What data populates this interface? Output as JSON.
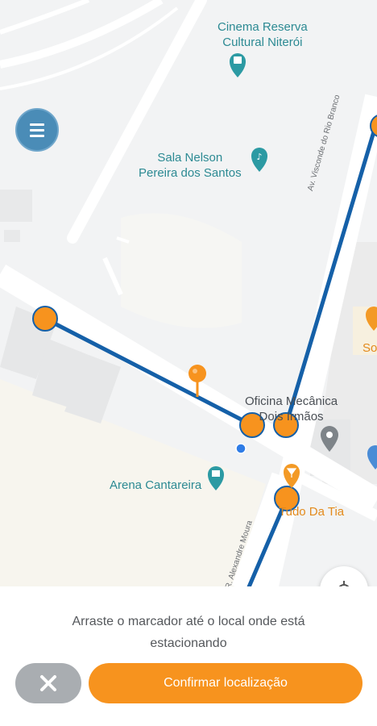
{
  "map": {
    "pois": {
      "cinema": "Cinema Reserva\nCultural Niterói",
      "sala": "Sala Nelson\nPereira dos Santos",
      "oficina": "Oficina Mecânica\nDois Irmãos",
      "arena": "Arena Cantareira",
      "tudo": "Tudo Da Tia",
      "so_partial": "So"
    },
    "streets": {
      "av_visconde": "Av. Visconde do Rio Branco",
      "alexandre_moura": "R. Alexandre Moura"
    },
    "colors": {
      "route": "#1560a8",
      "marker": "#f7931e",
      "teal_poi": "#2c8a93",
      "orange_poi": "#e38a1c"
    }
  },
  "controls": {
    "menu_icon": "menu-icon",
    "locate_icon": "crosshair-icon"
  },
  "panel": {
    "instruction": "Arraste o marcador até o local onde está estacionando",
    "cancel_icon": "close-icon",
    "confirm_label": "Confirmar localização"
  }
}
